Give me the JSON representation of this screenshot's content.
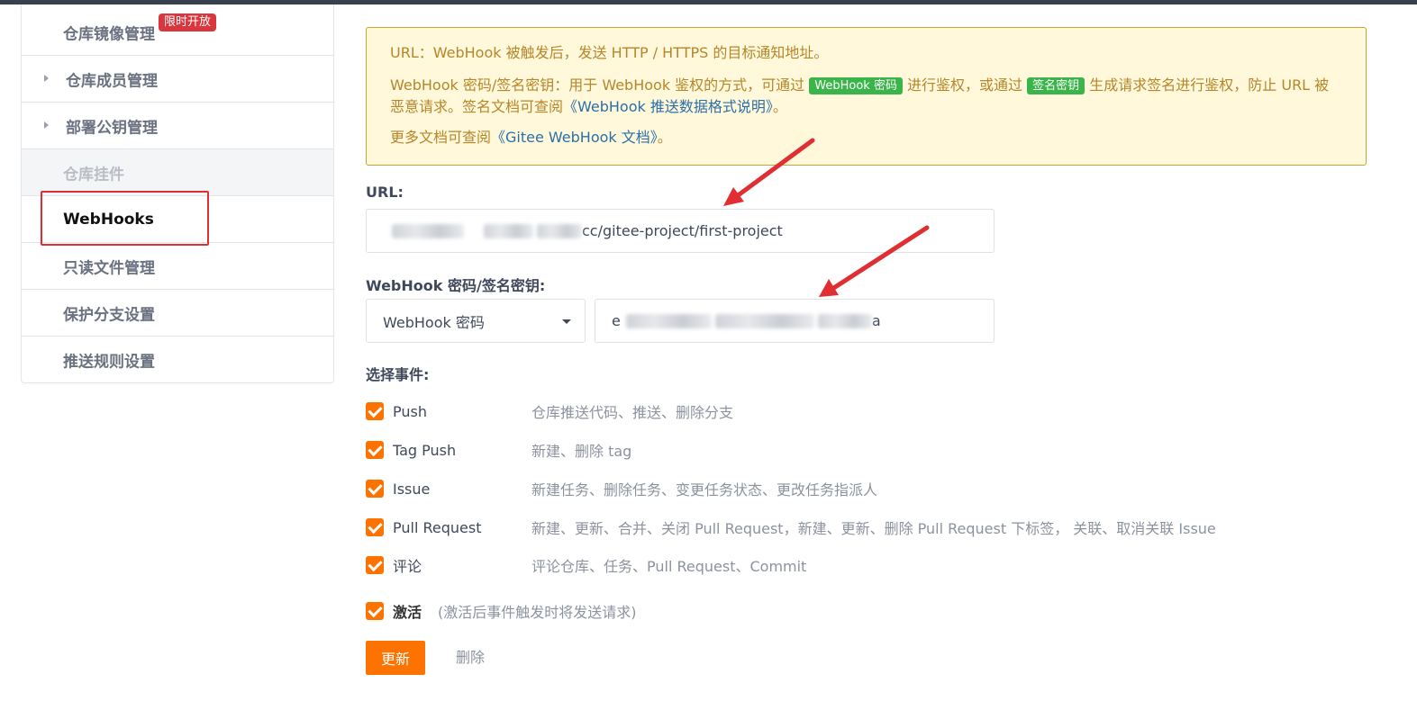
{
  "sidebar": {
    "items": [
      {
        "label": "仓库镜像管理",
        "badge": "限时开放"
      },
      {
        "label": "仓库成员管理"
      },
      {
        "label": "部署公钥管理"
      },
      {
        "label": "仓库挂件"
      },
      {
        "label": "WebHooks"
      },
      {
        "label": "只读文件管理"
      },
      {
        "label": "保护分支设置"
      },
      {
        "label": "推送规则设置"
      }
    ]
  },
  "notice": {
    "line1": "URL：WebHook 被触发后，发送 HTTP / HTTPS 的目标通知地址。",
    "line2_a": "WebHook 密码/签名密钥：用于 WebHook 鉴权的方式，可通过",
    "tag_password": "WebHook 密码",
    "line2_b": "进行鉴权，或通过",
    "tag_sign": "签名密钥",
    "line2_c": "生成请求签名进行鉴权，防止 URL 被恶意请求。签名文档可查阅",
    "link_format": "《WebHook 推送数据格式说明》",
    "line2_end": "。",
    "line3_a": "更多文档可查阅",
    "link_docs": "《Gitee WebHook 文档》",
    "line3_end": "。"
  },
  "form": {
    "url_label": "URL:",
    "url_value_visible": "cc/gitee-project/first-project",
    "secret_label": "WebHook 密码/签名密钥:",
    "secret_type": "WebHook 密码",
    "secret_prefix": "e",
    "secret_suffix": "a",
    "events_label": "选择事件:"
  },
  "events": [
    {
      "name": "Push",
      "desc": "仓库推送代码、推送、删除分支"
    },
    {
      "name": "Tag Push",
      "desc": "新建、删除 tag"
    },
    {
      "name": "Issue",
      "desc": "新建任务、删除任务、变更任务状态、更改任务指派人"
    },
    {
      "name": "Pull Request",
      "desc": "新建、更新、合并、关闭 Pull Request，新建、更新、删除 Pull Request 下标签， 关联、取消关联 Issue"
    },
    {
      "name": "评论",
      "desc": "评论仓库、任务、Pull Request、Commit"
    }
  ],
  "activate": {
    "label": "激活",
    "note": "(激活后事件触发时将发送请求)"
  },
  "buttons": {
    "update": "更新",
    "delete": "删除"
  },
  "colors": {
    "accent": "#fe7300",
    "badge": "#d9363e",
    "annotation": "#e02f33",
    "tag_green": "#39b54a"
  }
}
